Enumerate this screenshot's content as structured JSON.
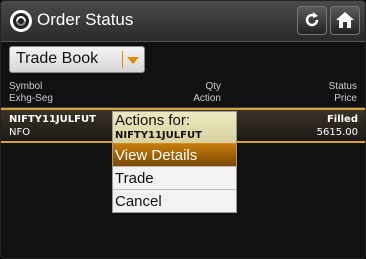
{
  "header": {
    "title": "Order Status",
    "icons": {
      "app": "app-logo-icon",
      "refresh": "refresh-icon",
      "home": "home-icon"
    }
  },
  "filter": {
    "selected": "Trade Book",
    "accent_color": "#e08a00"
  },
  "columns": {
    "left_top": "Symbol",
    "left_bottom": "Exhg-Seg",
    "mid_top": "Qty",
    "mid_bottom": "Action",
    "right_top": "Status",
    "right_bottom": "Price"
  },
  "rows": [
    {
      "symbol": "NIFTY11JULFUT",
      "exchange": "NFO",
      "status": "Filled",
      "price": "5615.00"
    }
  ],
  "menu": {
    "title": "Actions for:",
    "subtitle": "NIFTY11JULFUT",
    "items": [
      {
        "label": "View Details",
        "selected": true
      },
      {
        "label": "Trade",
        "selected": false
      },
      {
        "label": "Cancel",
        "selected": false
      }
    ]
  }
}
